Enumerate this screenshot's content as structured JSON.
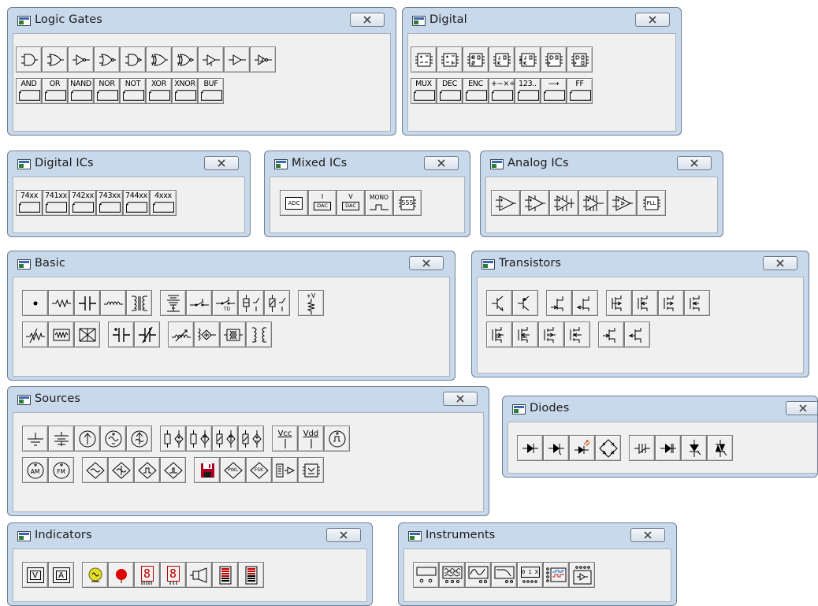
{
  "close_label": "close",
  "logic_gates": {
    "title": "Logic Gates",
    "labels": [
      "AND",
      "OR",
      "NAND",
      "NOR",
      "NOT",
      "XOR",
      "XNOR",
      "BUF"
    ]
  },
  "digital": {
    "title": "Digital",
    "labels": [
      "MUX",
      "DEC",
      "ENC",
      "+−×÷",
      "123..",
      "⟶",
      "FF"
    ]
  },
  "digital_ics": {
    "title": "Digital ICs",
    "labels": [
      "74xx",
      "741xx",
      "742xx",
      "743xx",
      "744xx",
      "4xxx"
    ]
  },
  "mixed_ics": {
    "title": "Mixed ICs",
    "labels": [
      "ADC",
      "I",
      "DAC",
      "V",
      "DAC",
      "MONO",
      "555"
    ]
  },
  "analog_ics": {
    "title": "Analog ICs",
    "labels": [
      "PLL"
    ]
  },
  "basic": {
    "title": "Basic",
    "labels": [
      "+V"
    ]
  },
  "transistors": {
    "title": "Transistors"
  },
  "sources": {
    "title": "Sources",
    "labels": [
      "Vcc",
      "Vdd",
      "AM",
      "FM",
      "PWL",
      "FSK"
    ]
  },
  "diodes": {
    "title": "Diodes"
  },
  "indicators": {
    "title": "Indicators",
    "labels": [
      "V",
      "A",
      "8",
      "8"
    ]
  },
  "instruments": {
    "title": "Instruments",
    "labels": [
      "0 1 X"
    ]
  }
}
